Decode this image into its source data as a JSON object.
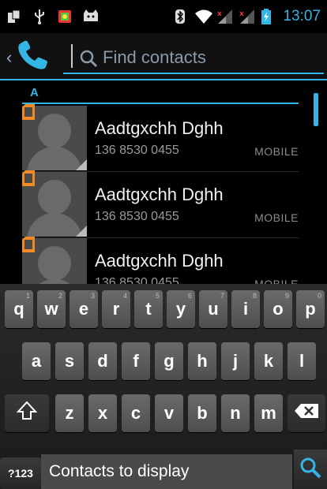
{
  "status_bar": {
    "time": "13:07"
  },
  "search": {
    "placeholder": "Find contacts"
  },
  "list": {
    "section_letter": "A",
    "contacts": [
      {
        "name": "Aadtgxchh Dghh",
        "number": "136 8530 0455",
        "type": "MOBILE"
      },
      {
        "name": "Aadtgxchh Dghh",
        "number": "136 8530 0455",
        "type": "MOBILE"
      },
      {
        "name": "Aadtgxchh Dghh",
        "number": "136 8530 0455",
        "type": "MOBILE"
      }
    ]
  },
  "keyboard": {
    "row1": [
      {
        "label": "q",
        "hint": "1"
      },
      {
        "label": "w",
        "hint": "2"
      },
      {
        "label": "e",
        "hint": "3"
      },
      {
        "label": "r",
        "hint": "4"
      },
      {
        "label": "t",
        "hint": "5"
      },
      {
        "label": "y",
        "hint": "6"
      },
      {
        "label": "u",
        "hint": "7"
      },
      {
        "label": "i",
        "hint": "8"
      },
      {
        "label": "o",
        "hint": "9"
      },
      {
        "label": "p",
        "hint": "0"
      }
    ],
    "row2": [
      "a",
      "s",
      "d",
      "f",
      "g",
      "h",
      "j",
      "k",
      "l"
    ],
    "row3": [
      "z",
      "x",
      "c",
      "v",
      "b",
      "n",
      "m"
    ],
    "symbols_label": "?123"
  },
  "suggestion": {
    "text": "Contacts to display"
  },
  "colors": {
    "accent": "#33b5e5",
    "sim_badge": "#f08a24"
  }
}
